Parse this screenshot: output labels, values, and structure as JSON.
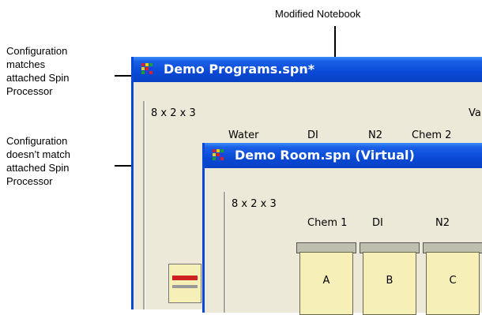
{
  "callouts": {
    "modified": "Modified Notebook",
    "matches": [
      "Configuration",
      "matches",
      "attached Spin",
      "Processor"
    ],
    "mismatch": [
      "Configuration",
      "doesn’t match",
      "attached Spin",
      "Processor"
    ]
  },
  "window_programs": {
    "title": "Demo Programs.spn*",
    "grid_label": "8 x 2 x 3",
    "partial_label": "Va",
    "columns": [
      "Water",
      "DI",
      "N2",
      "Chem 2"
    ]
  },
  "window_room": {
    "title": "Demo Room.spn (Virtual)",
    "grid_label": "8 x 2 x 3",
    "columns": [
      "Chem 1",
      "DI",
      "N2"
    ],
    "bowls": [
      "A",
      "B",
      "C"
    ]
  },
  "colors": {
    "titlebar": "#0a49d6",
    "window_bg": "#ece9d8",
    "bowl": "#f6efb8"
  }
}
